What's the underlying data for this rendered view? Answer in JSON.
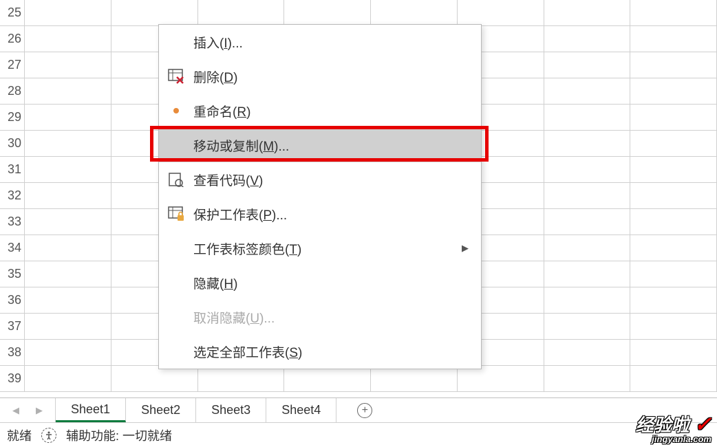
{
  "rows": [
    "25",
    "26",
    "27",
    "28",
    "29",
    "30",
    "31",
    "32",
    "33",
    "34",
    "35",
    "36",
    "37",
    "38",
    "39"
  ],
  "context_menu": {
    "insert": {
      "label": "插入(",
      "mnemonic": "I",
      "suffix": ")..."
    },
    "delete": {
      "label": "删除(",
      "mnemonic": "D",
      "suffix": ")"
    },
    "rename": {
      "label": "重命名(",
      "mnemonic": "R",
      "suffix": ")"
    },
    "move_copy": {
      "label": "移动或复制(",
      "mnemonic": "M",
      "suffix": ")..."
    },
    "view_code": {
      "label": "查看代码(",
      "mnemonic": "V",
      "suffix": ")"
    },
    "protect": {
      "label": "保护工作表(",
      "mnemonic": "P",
      "suffix": ")..."
    },
    "tab_color": {
      "label": "工作表标签颜色(",
      "mnemonic": "T",
      "suffix": ")"
    },
    "hide": {
      "label": "隐藏(",
      "mnemonic": "H",
      "suffix": ")"
    },
    "unhide": {
      "label": "取消隐藏(",
      "mnemonic": "U",
      "suffix": ")..."
    },
    "select_all": {
      "label": "选定全部工作表(",
      "mnemonic": "S",
      "suffix": ")"
    }
  },
  "tabs": {
    "sheet1": "Sheet1",
    "sheet2": "Sheet2",
    "sheet3": "Sheet3",
    "sheet4": "Sheet4"
  },
  "status": {
    "ready": "就绪",
    "accessibility": "辅助功能: 一切就绪"
  },
  "watermark": {
    "brand": "经验啦",
    "url": "jingyanla.com"
  }
}
